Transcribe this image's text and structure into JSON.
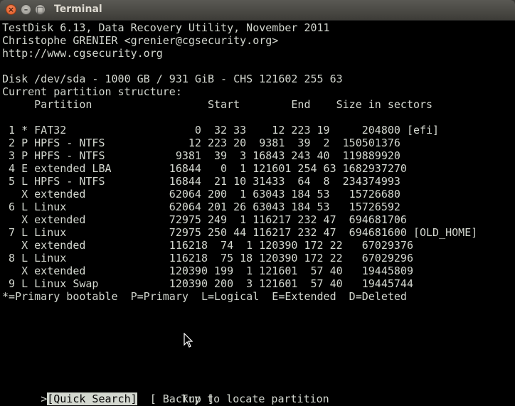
{
  "window": {
    "title": "Terminal"
  },
  "header": {
    "line1": "TestDisk 6.13, Data Recovery Utility, November 2011",
    "line2": "Christophe GRENIER <grenier@cgsecurity.org>",
    "line3": "http://www.cgsecurity.org"
  },
  "disk": {
    "info": "Disk /dev/sda - 1000 GB / 931 GiB - CHS 121602 255 63",
    "structure_label": "Current partition structure:",
    "columns_header": "     Partition                  Start        End    Size in sectors"
  },
  "partitions": [
    " 1 * FAT32                    0  32 33    12 223 19     204800 [efi]",
    " 2 P HPFS - NTFS             12 223 20  9381  39  2  150501376",
    " 3 P HPFS - NTFS           9381  39  3 16843 243 40  119889920",
    " 4 E extended LBA         16844   0  1 121601 254 63 1682937270",
    " 5 L HPFS - NTFS          16844  21 10 31433  64  8  234374993",
    "   X extended             62064 200  1 63043 184 53   15726680",
    " 6 L Linux                62064 201 26 63043 184 53   15726592",
    "   X extended             72975 249  1 116217 232 47  694681706",
    " 7 L Linux                72975 250 44 116217 232 47  694681600 [OLD_HOME]",
    "   X extended             116218  74  1 120390 172 22   67029376",
    " 8 L Linux                116218  75 18 120390 172 22   67029296",
    "   X extended             120390 199  1 121601  57 40   19445809",
    " 9 L Linux Swap           120390 200  3 121601  57 40   19445744"
  ],
  "legend": "*=Primary bootable  P=Primary  L=Logical  E=Extended  D=Deleted",
  "menu": {
    "quick_search_prefix": ">",
    "quick_search": "[Quick Search]",
    "backup": "[ Backup ]",
    "hint": "Try to locate partition"
  },
  "icons": {
    "close": "close-icon",
    "minimize": "minimize-icon",
    "maximize": "maximize-icon",
    "pointer": "mouse-pointer-icon"
  }
}
